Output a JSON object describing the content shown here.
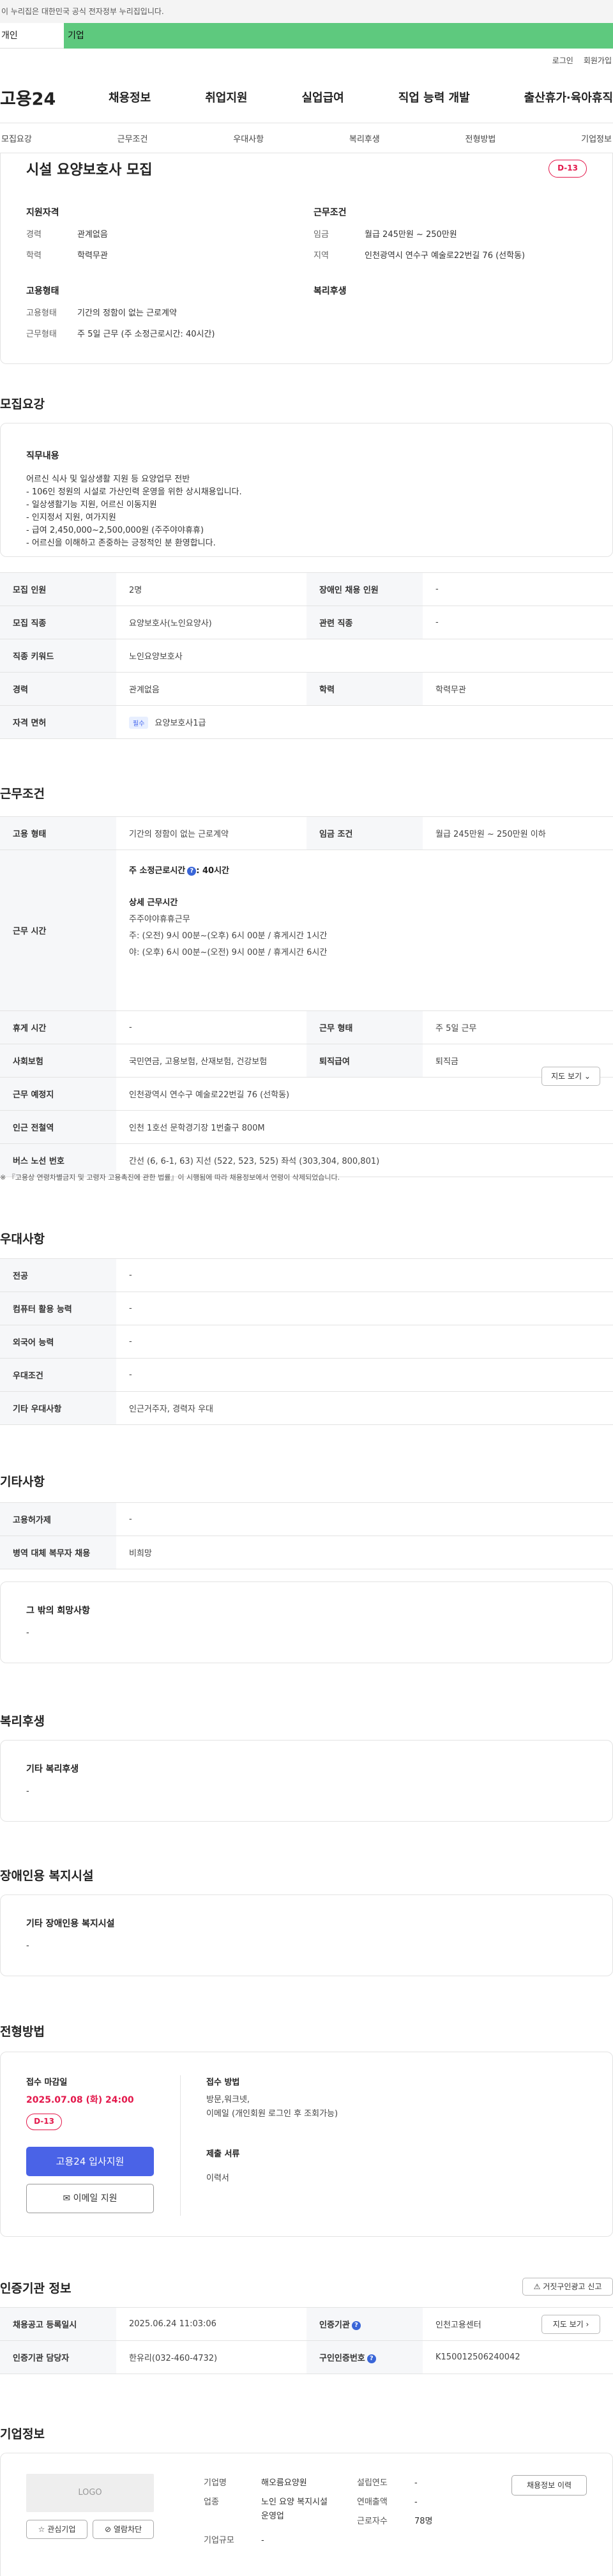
{
  "gov_banner": "이 누리집은 대한민국 공식 전자정부 누리집입니다.",
  "tabs": {
    "personal": "개인",
    "corporate": "기업"
  },
  "util": {
    "login": "로그인",
    "join": "회원가입"
  },
  "logo": "고용24",
  "gnb": [
    "채용정보",
    "취업지원",
    "실업급여",
    "직업 능력 개발",
    "출산휴가·육아휴직"
  ],
  "snb": [
    "모집요강",
    "근무조건",
    "우대사항",
    "복리후생",
    "전형방법",
    "기업정보"
  ],
  "summary": {
    "title": "시설 요양보호사 모집",
    "dday": "D-13",
    "qual_heading": "지원자격",
    "qual": [
      {
        "k": "경력",
        "v": "관계없음"
      },
      {
        "k": "학력",
        "v": "학력무관"
      }
    ],
    "cond_heading": "근무조건",
    "cond": [
      {
        "k": "임금",
        "v": "월급 245만원 ~ 250만원"
      },
      {
        "k": "지역",
        "v": "인천광역시 연수구 예술로22번길 76 (선학동)"
      }
    ],
    "emp_heading": "고용형태",
    "emp": [
      {
        "k": "고용형태",
        "v": "기간의 정함이 없는 근로계약"
      },
      {
        "k": "근무형태",
        "v": "주 5일 근무 (주 소정근로시간: 40시간)"
      }
    ],
    "welfare_heading": "복리후생"
  },
  "recruit": {
    "title": "모집요강",
    "duty_heading": "직무내용",
    "duty_text": "어르신 식사 및 일상생활 지원 등 요양업무 전반\n- 106인 정원의 시설로 가산인력 운영을 위한 상시채용입니다.\n- 일상생활기능 지원,  어르신 이동지원\n- 인지정서 지원, 여가지원\n- 급여 2,450,000~2,500,000원 (주주야야휴휴)\n- 어르신을 이해하고 존중하는 긍정적인 분 환영합니다.",
    "rows": [
      {
        "k1": "모집 인원",
        "v1": "2명",
        "k2": "장애인 채용 인원",
        "v2": "-"
      },
      {
        "k1": "모집 직종",
        "v1": "요양보호사(노인요양사)",
        "k2": "관련 직종",
        "v2": "-"
      },
      {
        "k1": "직종 키워드",
        "v1": "노인요양보호사"
      },
      {
        "k1": "경력",
        "v1": "관계없음",
        "k2": "학력",
        "v2": "학력무관"
      },
      {
        "k1": "자격 면허",
        "badge": "필수",
        "v1": "요양보호사1급"
      }
    ]
  },
  "work": {
    "title": "근무조건",
    "row1": {
      "k1": "고용 형태",
      "v1": "기간의 정함이 없는 근로계약",
      "k2": "임금 조건",
      "v2": "월급 245만원 ~ 250만원 이하"
    },
    "time_key": "근무 시간",
    "time_main_label": "주 소정근로시간",
    "time_main_value": ": 40시간",
    "time_detail_heading": "상세 근무시간",
    "time_detail_lines": [
      "주주야야휴휴근무",
      "주: (오전) 9시 00분~(오후) 6시 00분 / 휴게시간 1시간",
      "야: (오후) 6시 00분~(오전) 9시 00분 / 휴게시간 6시간"
    ],
    "rows": [
      {
        "k1": "휴게 시간",
        "v1": "-",
        "k2": "근무 형태",
        "v2": "주 5일 근무"
      },
      {
        "k1": "사회보험",
        "v1": "국민연금, 고용보험, 산재보험, 건강보험",
        "k2": "퇴직급여",
        "v2": "퇴직금"
      }
    ],
    "location_key": "근무 예정지",
    "location_value": "인천광역시 연수구 예술로22번길 76 (선학동)",
    "map_button": "지도 보기",
    "subway_key": "인근 전철역",
    "subway_value": "인천 1호선 문학경기장 1번출구 800M",
    "bus_key": "버스 노선 번호",
    "bus_value": "간선 (6, 6-1, 63) 지선 (522, 523, 525) 좌석 (303,304, 800,801)",
    "note": "※ 『고용상 연령차별금지 및 고령자 고용촉진에 관한 법률』이 시행됨에 따라 채용정보에서 연령이 삭제되었습니다."
  },
  "pref": {
    "title": "우대사항",
    "rows": [
      {
        "k": "전공",
        "v": "-"
      },
      {
        "k": "컴퓨터 활용 능력",
        "v": "-"
      },
      {
        "k": "외국어 능력",
        "v": "-"
      },
      {
        "k": "우대조건",
        "v": "-"
      },
      {
        "k": "기타 우대사항",
        "v": "인근거주자, 경력자 우대"
      }
    ]
  },
  "etc": {
    "title": "기타사항",
    "rows": [
      {
        "k": "고용허가제",
        "v": "-"
      },
      {
        "k": "병역 대체 복무자 채용",
        "v": "비희망"
      }
    ],
    "other_heading": "그 밖의 희망사항",
    "other_value": "-"
  },
  "welfare": {
    "title": "복리후생",
    "heading": "기타 복리후생",
    "value": "-"
  },
  "disabled": {
    "title": "장애인용 복지시설",
    "heading": "기타 장애인용 복지시설",
    "value": "-"
  },
  "selection": {
    "title": "전형방법",
    "deadline_label": "접수 마감일",
    "deadline": "2025.07.08 (화) 24:00",
    "dday": "D-13",
    "apply_button": "고용24 입사지원",
    "email_button": "이메일 지원",
    "method_label": "접수 방법",
    "method_value": "방문,워크넷,\n이메일 (개인회원 로그인 후 조회가능)",
    "docs_label": "제출 서류",
    "docs_value": "이력서"
  },
  "agency": {
    "title": "인증기관 정보",
    "report_button": "거짓구인광고 신고",
    "rows": [
      {
        "k1": "채용공고 등록일시",
        "v1": "2025.06.24 11:03:06",
        "k2": "인증기관",
        "v2": "인천고용센터",
        "btn": "지도 보기"
      },
      {
        "k1": "인증기관 담당자",
        "v1": "한유리(032-460-4732)",
        "k2": "구인인증번호",
        "v2": "K150012506240042"
      }
    ]
  },
  "company": {
    "title": "기업정보",
    "logo": "LOGO",
    "fav_button": "관심기업",
    "block_button": "열람차단",
    "history_button": "채용정보 이력",
    "fields": {
      "name_k": "기업명",
      "name_v": "해오름요양원",
      "industry_k": "업종",
      "industry_v": "노인 요양 복지시설 운영업",
      "size_k": "기업규모",
      "size_v": "-",
      "founded_k": "설립연도",
      "founded_v": "-",
      "sales_k": "연매출액",
      "sales_v": "-",
      "emp_k": "근로자수",
      "emp_v": "78명"
    }
  },
  "colors": {
    "accent": "#4a63e7",
    "dday": "#e3184b",
    "corp_tab": "#5ec97e"
  }
}
